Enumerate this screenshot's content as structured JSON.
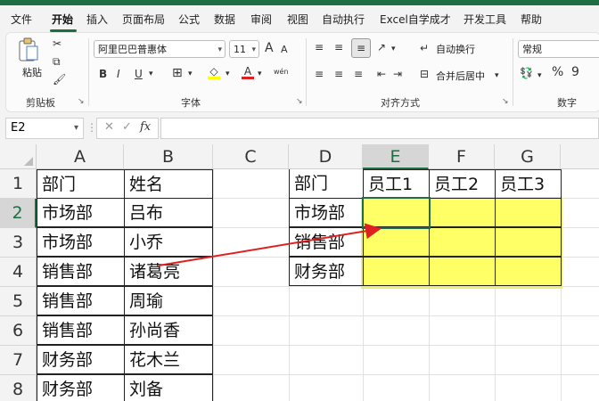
{
  "menu": {
    "tabs": [
      "文件",
      "开始",
      "插入",
      "页面布局",
      "公式",
      "数据",
      "审阅",
      "视图",
      "自动执行",
      "Excel自学成才",
      "开发工具",
      "帮助"
    ],
    "active": "开始"
  },
  "ribbon": {
    "paste_label": "粘贴",
    "clipboard_label": "剪贴板",
    "font_name": "阿里巴巴普惠体",
    "font_size": "11",
    "font_label": "字体",
    "bold": "B",
    "italic": "I",
    "underline": "U",
    "wrap_text": "自动换行",
    "merge_center": "合并后居中",
    "align_label": "对齐方式",
    "number_format": "常规",
    "number_label": "数字",
    "percent": "%",
    "font_grow": "A",
    "font_shrink": "A",
    "phonetic": "wén"
  },
  "formula_bar": {
    "name_box": "E2",
    "fx": "fx",
    "formula": ""
  },
  "columns": [
    "A",
    "B",
    "C",
    "D",
    "E",
    "F",
    "G"
  ],
  "rows": [
    "1",
    "2",
    "3",
    "4",
    "5",
    "6",
    "7",
    "8"
  ],
  "selected": {
    "column": "E",
    "row": "2"
  },
  "table1": {
    "headers": [
      "部门",
      "姓名"
    ],
    "rows": [
      [
        "市场部",
        "吕布"
      ],
      [
        "市场部",
        "小乔"
      ],
      [
        "销售部",
        "诸葛亮"
      ],
      [
        "销售部",
        "周瑜"
      ],
      [
        "销售部",
        "孙尚香"
      ],
      [
        "财务部",
        "花木兰"
      ],
      [
        "财务部",
        "刘备"
      ]
    ]
  },
  "table2": {
    "corner": "部门",
    "col_headers": [
      "员工1",
      "员工2",
      "员工3"
    ],
    "row_labels": [
      "市场部",
      "销售部",
      "财务部"
    ]
  },
  "colors": {
    "excel_green": "#1e6e42",
    "highlight": "#ffff66",
    "arrow": "#e02020"
  }
}
